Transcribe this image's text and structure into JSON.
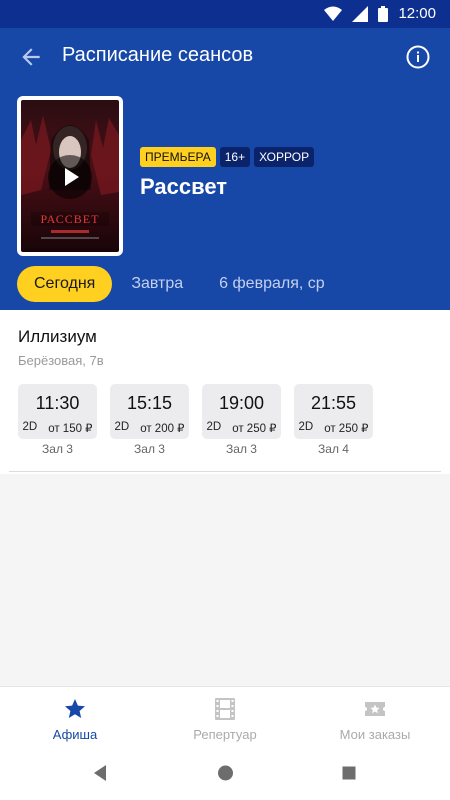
{
  "status_bar": {
    "time": "12:00",
    "icons": [
      "wifi-icon",
      "signal-icon",
      "battery-icon"
    ]
  },
  "header": {
    "title": "Расписание сеансов",
    "back_icon": "arrow-back-icon",
    "info_icon": "info-icon"
  },
  "movie": {
    "title": "Рассвет",
    "poster_title": "РАССВЕТ",
    "badges": {
      "premiere": "ПРЕМЬЕРА",
      "age": "16+",
      "genre": "ХОРРОР"
    }
  },
  "date_tabs": [
    {
      "label": "Сегодня",
      "active": true
    },
    {
      "label": "Завтра",
      "active": false
    },
    {
      "label": "6 февраля, ср",
      "active": false
    }
  ],
  "cinema": {
    "name": "Иллизиум",
    "address": "Берёзовая, 7в",
    "sessions": [
      {
        "time": "11:30",
        "format": "2D",
        "price": "от 150 ₽",
        "hall": "Зал 3"
      },
      {
        "time": "15:15",
        "format": "2D",
        "price": "от 200 ₽",
        "hall": "Зал 3"
      },
      {
        "time": "19:00",
        "format": "2D",
        "price": "от 250 ₽",
        "hall": "Зал 3"
      },
      {
        "time": "21:55",
        "format": "2D",
        "price": "от 250 ₽",
        "hall": "Зал 4"
      }
    ]
  },
  "bottom_nav": [
    {
      "label": "Афиша",
      "icon": "star-icon",
      "active": true
    },
    {
      "label": "Репертуар",
      "icon": "film-icon",
      "active": false
    },
    {
      "label": "Мои заказы",
      "icon": "ticket-icon",
      "active": false
    }
  ],
  "colors": {
    "header": "#1748a8",
    "status_bar": "#0d2f8f",
    "accent": "#ffd020",
    "badge_dark": "#0b236a"
  }
}
